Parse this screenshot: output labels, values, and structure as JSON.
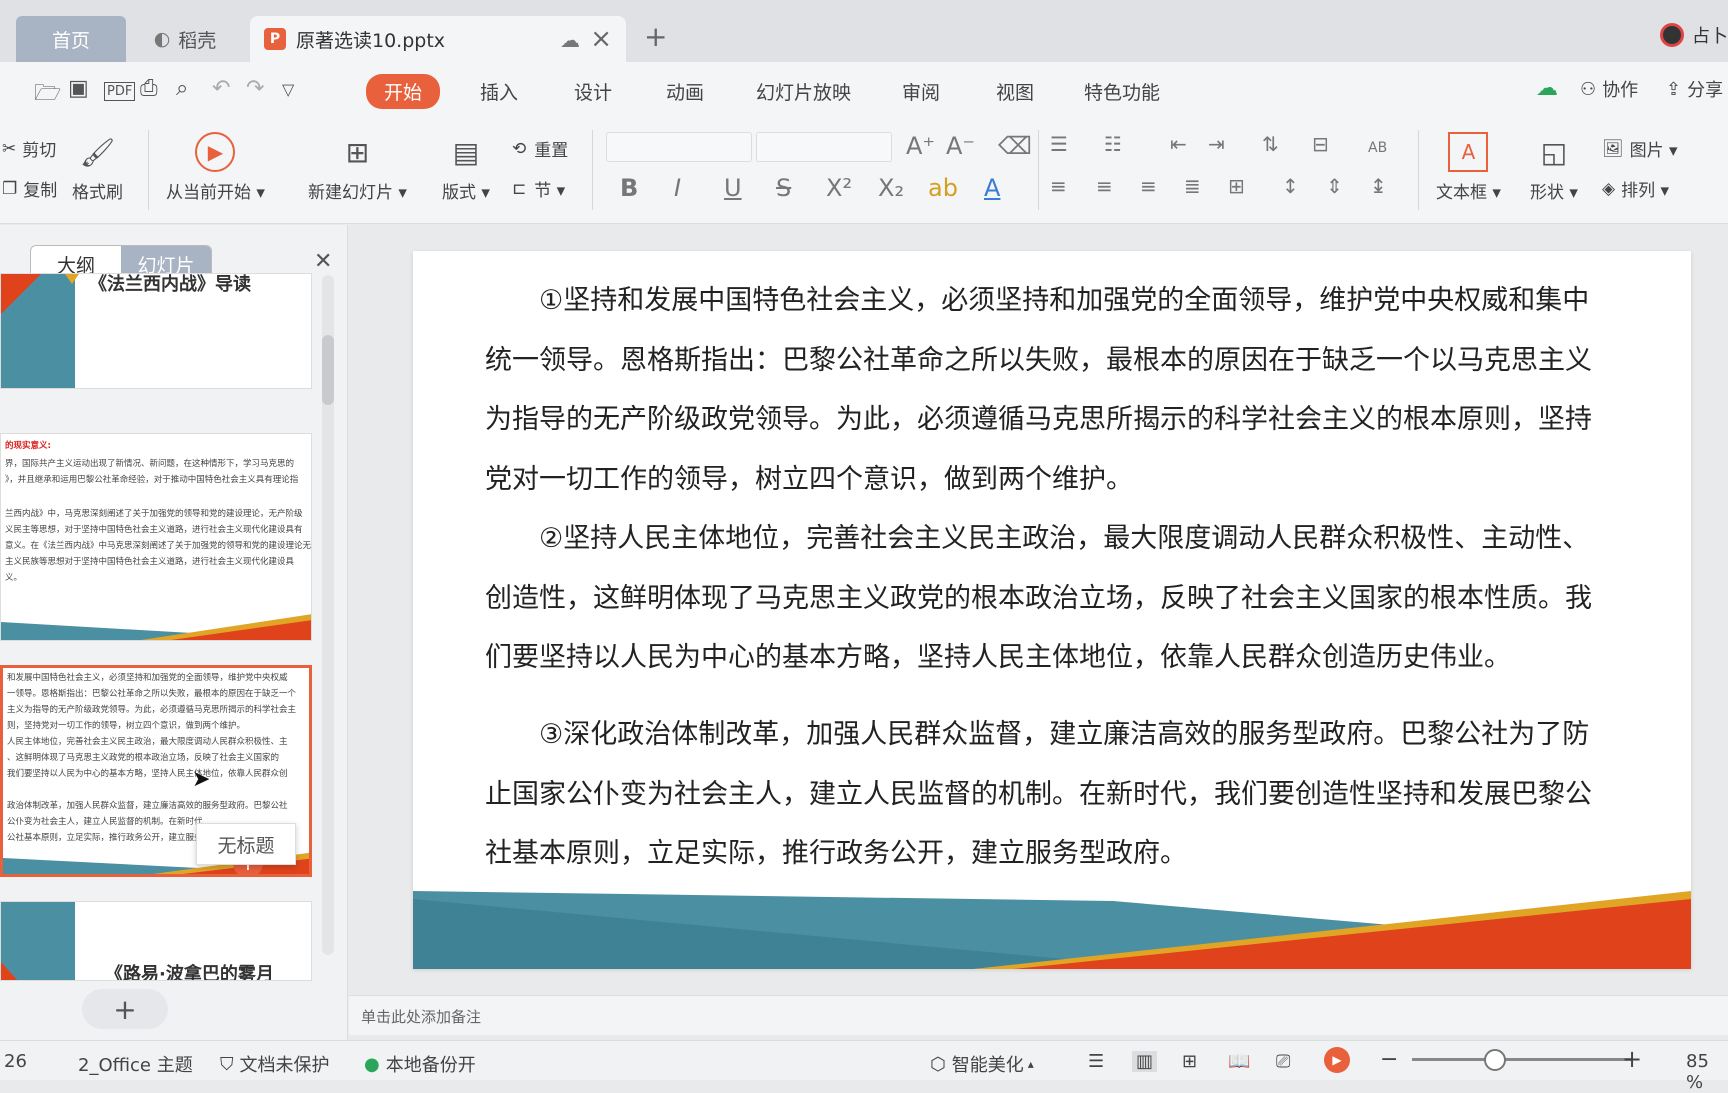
{
  "tabs": {
    "home": "首页",
    "daoke": "稻壳",
    "file": "原著选读10.pptx"
  },
  "user": {
    "name": "占卜"
  },
  "menu": {
    "items": [
      "开始",
      "插入",
      "设计",
      "动画",
      "幻灯片放映",
      "审阅",
      "视图",
      "特色功能"
    ],
    "collaborate": "协作",
    "share": "分享"
  },
  "ribbon": {
    "cut": "剪切",
    "copy": "复制",
    "format_painter": "格式刷",
    "from_current": "从当前开始",
    "new_slide": "新建幻灯片",
    "layout": "版式",
    "reset": "重置",
    "section": "节",
    "textbox": "文本框",
    "shape": "形状",
    "picture": "图片",
    "arrange": "排列"
  },
  "left_pane": {
    "outline_tab": "大纲",
    "slides_tab": "幻灯片",
    "thumb1_title": "《法兰西内战》导读",
    "thumb2_lines": [
      "的现实意义:",
      "界，国际共产主义运动出现了新情况、新问题，在这种情形下，学习马克思的",
      "》，并且继承和运用巴黎公社革命经验，对于推动中国特色社会主义具有理论指",
      "",
      "兰西内战》中，马克思深刻阐述了关于加强党的领导和党的建设理论，无产阶级",
      "义民主等思想，对于坚持中国特色社会主义道路，进行社会主义现代化建设具有",
      "意义。在《法兰西内战》中马克思深刻阐述了关于加强党的领导和党的建设理论无产",
      "主义民族等思想对于坚持中国特色社会主义道路，进行社会主义现代化建设具",
      "义。"
    ],
    "thumb3_lines": [
      "和发展中国特色社会主义，必须坚持和加强党的全面领导，维护党中央权威",
      "一领导。恩格斯指出：巴黎公社革命之所以失败，最根本的原因在于缺乏一个",
      "主义为指导的无产阶级政党领导。为此，必须遵循马克思所揭示的科学社会主",
      "则，坚持党对一切工作的领导，树立四个意识，做到两个维护。",
      "人民主体地位，完善社会主义民主政治，最大限度调动人民群众积极性、主",
      "、这鲜明体现了马克思主义政党的根本政治立场，反映了社会主义国家的",
      "我们要坚持以人民为中心的基本方略，坚持人民主体地位，依靠人民群众创",
      "",
      "政治体制改革，加强人民群众监督，建立廉洁高效的服务型政府。巴黎公社",
      "公仆变为社会主人，建立人民监督的机制。在新时代",
      "公社基本原则，立足实际，推行政务公开，建立服务型政府"
    ],
    "thumb4_title": "《路易·波拿巴的雾月",
    "tooltip": "无标题"
  },
  "slide": {
    "paragraphs": [
      "①坚持和发展中国特色社会主义，必须坚持和加强党的全面领导，维护党中央权威和集中统一领导。恩格斯指出：巴黎公社革命之所以失败，最根本的原因在于缺乏一个以马克思主义为指导的无产阶级政党领导。为此，必须遵循马克思所揭示的科学社会主义的根本原则，坚持党对一切工作的领导，树立四个意识，做到两个维护。",
      "②坚持人民主体地位，完善社会主义民主政治，最大限度调动人民群众积极性、主动性、创造性，这鲜明体现了马克思主义政党的根本政治立场，反映了社会主义国家的根本性质。我们要坚持以人民为中心的基本方略，坚持人民主体地位，依靠人民群众创造历史伟业。",
      "③深化政治体制改革，加强人民群众监督，建立廉洁高效的服务型政府。巴黎公社为了防止国家公仆变为社会主人，建立人民监督的机制。在新时代，我们要创造性坚持和发展巴黎公社基本原则，立足实际，推行政务公开，建立服务型政府。"
    ]
  },
  "notes_placeholder": "单击此处添加备注",
  "status": {
    "slide_num": "26",
    "theme": "2_Office 主题",
    "protect": "文档未保护",
    "backup": "本地备份开",
    "beautify": "智能美化",
    "zoom": "85 %"
  },
  "colors": {
    "accent": "#e8603c",
    "teal": "#4b8fa3",
    "gold": "#e1a526",
    "orange_red": "#e0431c"
  }
}
